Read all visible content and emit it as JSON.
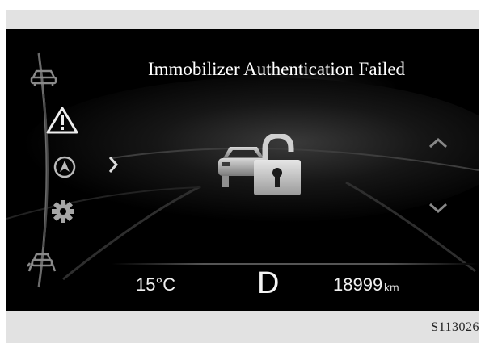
{
  "display": {
    "message": "Immobilizer Authentication Failed",
    "temperature": "15°C",
    "gear": "D",
    "odometer_value": "18999",
    "odometer_unit": "km"
  },
  "sidebar": {
    "items": [
      {
        "icon": "car-icon"
      },
      {
        "icon": "warning-icon",
        "selected": true
      },
      {
        "icon": "navigation-icon"
      },
      {
        "icon": "settings-gear-icon"
      },
      {
        "icon": "driver-assist-icon"
      }
    ]
  },
  "main_icon": "immobilizer-lock-icon",
  "figure_caption": "S113026",
  "colors": {
    "background": "#000000",
    "frame": "#e2e2e2",
    "text": "#ffffff",
    "icon": "#d6d6d6"
  }
}
